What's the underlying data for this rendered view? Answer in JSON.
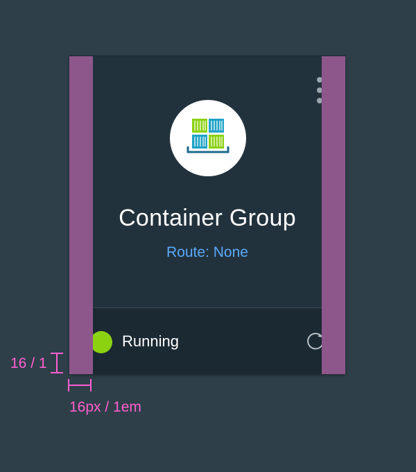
{
  "card": {
    "title": "Container Group",
    "route": "Route: None",
    "status": {
      "label": "Running",
      "color": "#8cd211"
    },
    "icon": "container-stack-icon",
    "menu_icon": "overflow-menu-icon",
    "refresh_icon": "refresh-icon"
  },
  "annotations": {
    "vertical_spacing": "16 / 1",
    "horizontal_spacing": "16px / 1em",
    "color": "#ff5fd0"
  },
  "colors": {
    "background": "#2f3f49",
    "card": "#22323d",
    "footer": "#1b2932",
    "padding_overlay": "#8e578b",
    "accent_blue": "#5aaafa",
    "container_green": "#8cd211",
    "container_blue": "#1fa3c7"
  }
}
